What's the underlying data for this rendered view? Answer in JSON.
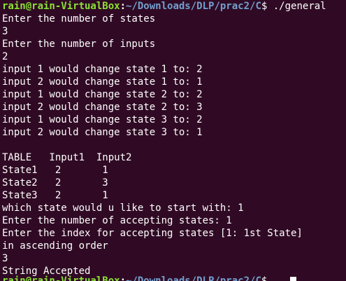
{
  "terminal": {
    "prompt": {
      "user_host": "rain@rain-VirtualBox",
      "separator": ":",
      "path": "~/Downloads/DLP/prac2/C",
      "symbol": "$ ",
      "command": "./general"
    },
    "lines": [
      "Enter the number of states",
      "3",
      "Enter the number of inputs",
      "2",
      "input 1 would change state 1 to: 2",
      "input 2 would change state 1 to: 1",
      "input 1 would change state 2 to: 2",
      "input 2 would change state 2 to: 3",
      "input 1 would change state 3 to: 2",
      "input 2 would change state 3 to: 1",
      "",
      "TABLE   Input1  Input2",
      "State1   2       1",
      "State2   2       3",
      "State3   2       1",
      "which state would u like to start with: 1",
      "Enter the number of accepting states: 1",
      "Enter the index for accepting states [1: 1st State]",
      "in ascending order",
      "3",
      "String Accepted"
    ],
    "colors": {
      "background": "#300a24",
      "text": "#ffffff",
      "user_host": "#8ae234",
      "path": "#729fcf"
    }
  }
}
